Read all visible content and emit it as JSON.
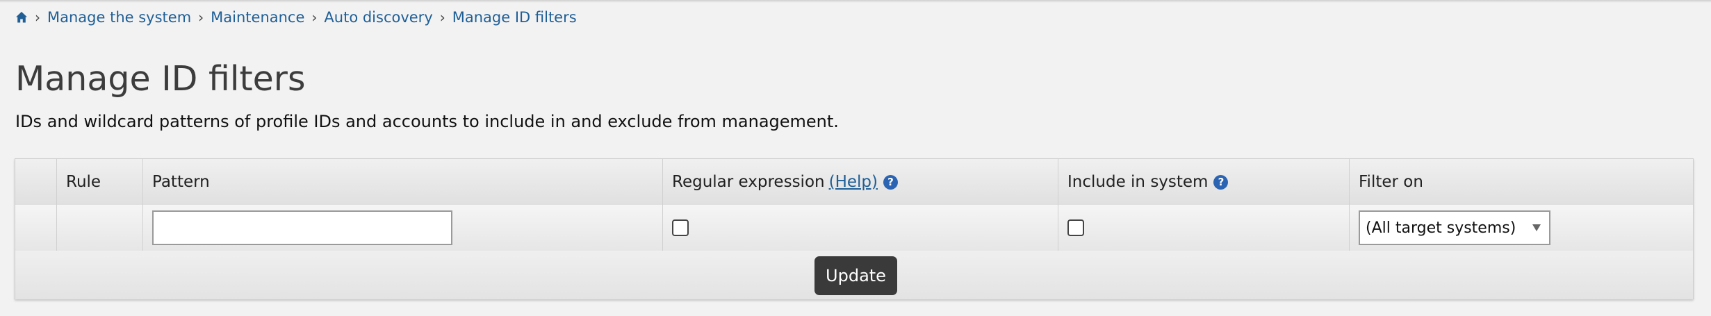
{
  "breadcrumb": {
    "home_icon": "home-icon",
    "items": [
      "Manage the system",
      "Maintenance",
      "Auto discovery",
      "Manage ID filters"
    ]
  },
  "page": {
    "title": "Manage ID filters",
    "description": "IDs and wildcard patterns of profile IDs and accounts to include in and exclude from management."
  },
  "table": {
    "headers": {
      "rule": "Rule",
      "pattern": "Pattern",
      "regex": "Regular expression",
      "regex_help": "(Help)",
      "include": "Include in system",
      "filter_on": "Filter on"
    },
    "new_row": {
      "pattern_value": "",
      "regex_checked": false,
      "include_checked": false,
      "filter_on_selected": "(All target systems)"
    },
    "update_label": "Update"
  },
  "colors": {
    "link": "#1f5f96",
    "help_icon": "#2a64b3",
    "button_bg": "#3a3a3a",
    "page_bg": "#f2f2f2"
  }
}
